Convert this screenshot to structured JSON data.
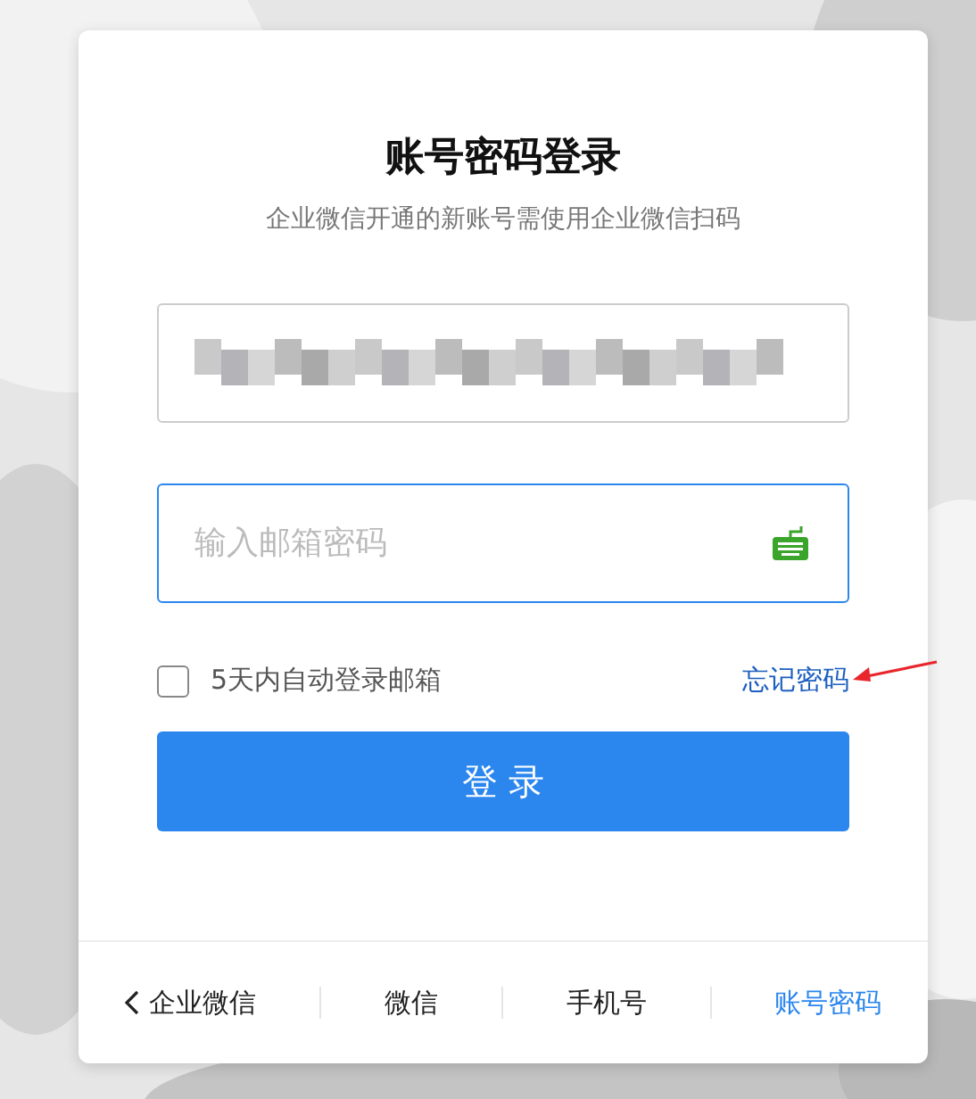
{
  "title": "账号密码登录",
  "subtitle": "企业微信开通的新账号需使用企业微信扫码",
  "account_field": {
    "redacted": true
  },
  "password_field": {
    "placeholder": "输入邮箱密码",
    "focused": true
  },
  "remember": {
    "label": "5天内自动登录邮箱",
    "checked": false
  },
  "forgot_link": "忘记密码",
  "login_button": "登 录",
  "footer_tabs": [
    {
      "label": "企业微信",
      "kind": "back",
      "selected": false
    },
    {
      "label": "微信",
      "kind": "plain",
      "selected": false
    },
    {
      "label": "手机号",
      "kind": "plain",
      "selected": false
    },
    {
      "label": "账号密码",
      "kind": "plain",
      "selected": true
    }
  ],
  "annotation": {
    "kind": "arrow"
  }
}
